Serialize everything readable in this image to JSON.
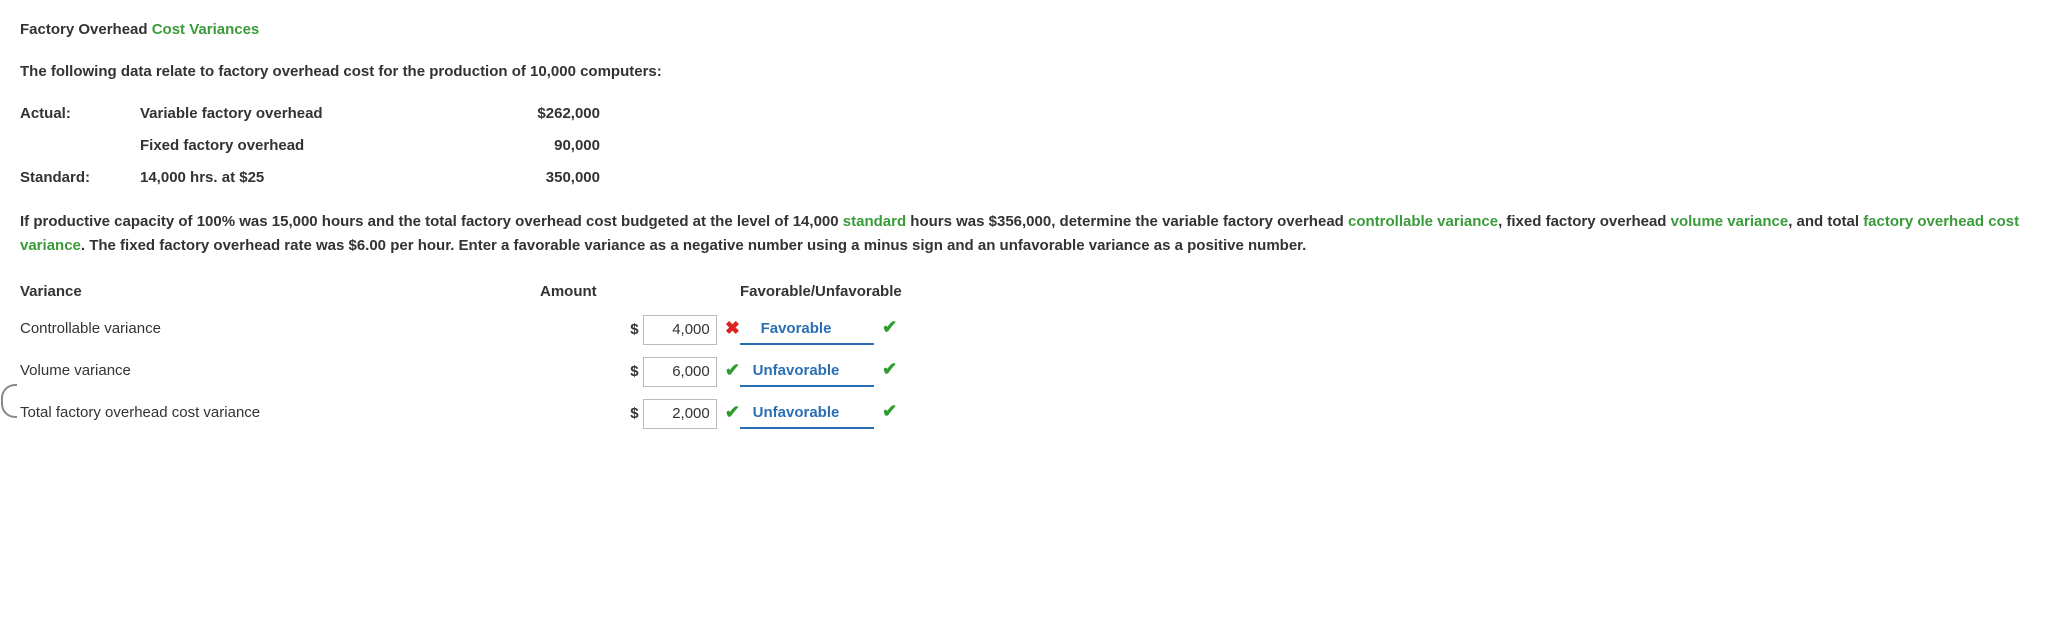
{
  "title": {
    "part1": "Factory Overhead ",
    "part2": "Cost Variances"
  },
  "intro": "The following data relate to factory overhead cost for the production of 10,000 computers:",
  "data_rows": [
    {
      "c1": "Actual:",
      "c2": "Variable factory overhead",
      "amt": "$262,000"
    },
    {
      "c1": "",
      "c2": "Fixed factory overhead",
      "amt": "90,000"
    },
    {
      "c1": "Standard:",
      "c2": "14,000 hrs. at $25",
      "amt": "350,000"
    }
  ],
  "para": {
    "seg1": "If productive capacity of 100% was 15,000 hours and the total factory overhead cost budgeted at the level of 14,000 ",
    "term1": "standard",
    "seg2": " hours was $356,000, determine the variable factory overhead ",
    "term2": "controllable variance",
    "seg3": ", fixed factory overhead ",
    "term3": "volume variance",
    "seg4": ", and total ",
    "term4": "factory overhead cost variance",
    "seg5": ". The fixed factory overhead rate was $6.00 per hour. Enter a favorable variance as a negative number using a minus sign and an unfavorable variance as a positive number."
  },
  "headers": {
    "variance": "Variance",
    "amount": "Amount",
    "fu": "Favorable/Unfavorable"
  },
  "rows": [
    {
      "label": "Controllable variance",
      "amount": "4,000",
      "amount_status": "wrong",
      "fu": "Favorable",
      "fu_status": "correct"
    },
    {
      "label": "Volume variance",
      "amount": "6,000",
      "amount_status": "correct",
      "fu": "Unfavorable",
      "fu_status": "correct"
    },
    {
      "label": "Total factory overhead cost variance",
      "amount": "2,000",
      "amount_status": "correct",
      "fu": "Unfavorable",
      "fu_status": "correct"
    }
  ],
  "currency": "$"
}
